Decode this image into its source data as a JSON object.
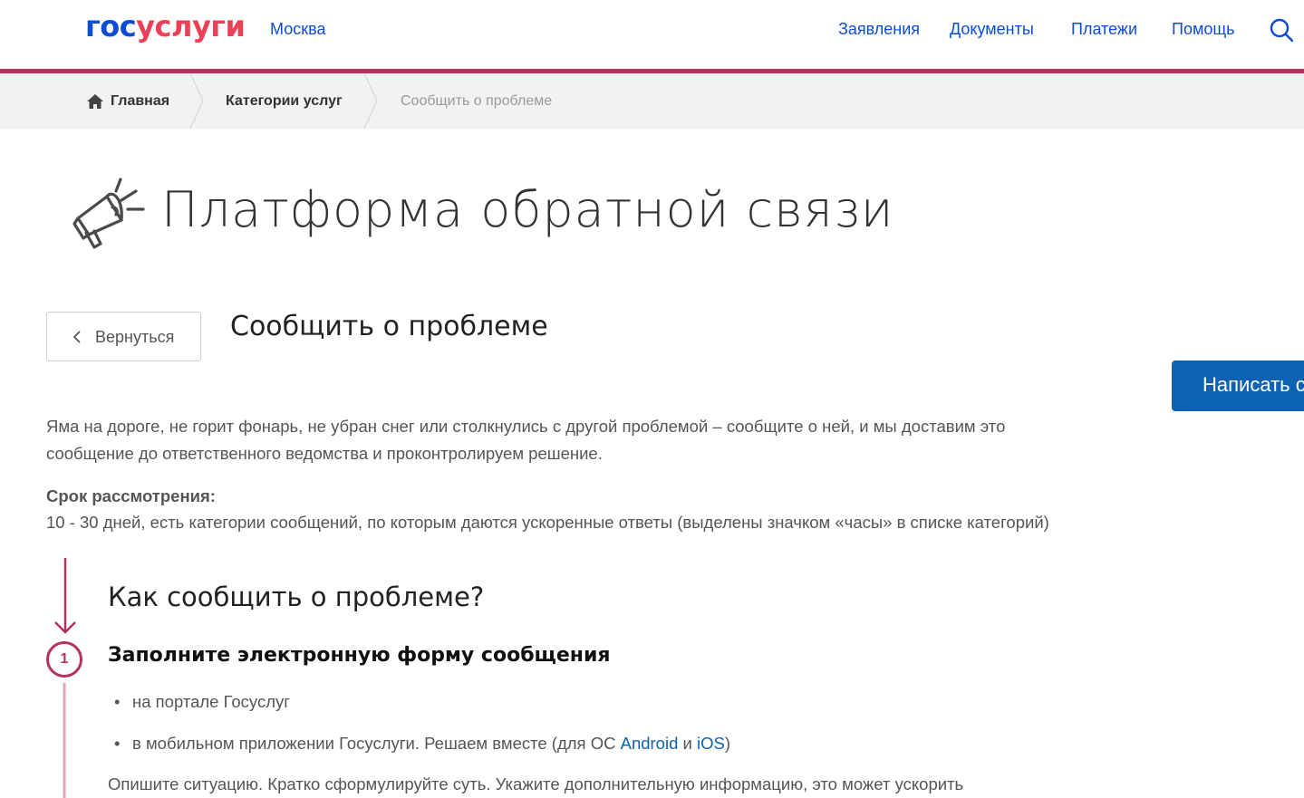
{
  "header": {
    "logo_part1": "гос",
    "logo_part2": "услуги",
    "city": "Москва",
    "nav": [
      "Заявления",
      "Документы",
      "Платежи",
      "Помощь"
    ]
  },
  "breadcrumbs": {
    "home": "Главная",
    "categories": "Категории услуг",
    "current": "Сообщить о проблеме"
  },
  "page": {
    "title": "Платформа обратной связи",
    "back_label": "Вернуться",
    "section_title": "Сообщить о проблеме",
    "write_button": "Написать с",
    "intro": "Яма на дороге, не горит фонарь, не убран снег или столкнулись с другой проблемой – сообщите о ней, и мы доставим это сообщение до ответственного ведомства и проконтролируем решение.",
    "term_title": "Срок рассмотрения:",
    "term_text": "10 - 30 дней, есть категории сообщений, по которым даются ускоренные ответы (выделены значком «часы» в списке категорий)"
  },
  "how": {
    "title": "Как сообщить о проблеме?",
    "step_number": "1",
    "step_title": "Заполните электронную форму сообщения",
    "bullet1": "на портале Госуслуг",
    "bullet2_text": "в мобильном приложении Госуслуги. Решаем вместе (для ОС",
    "bullet2_link1": "Android",
    "bullet2_and": "и",
    "bullet2_link2": "iOS",
    "bullet2_close": ")",
    "description": "Опишите ситуацию. Кратко сформулируйте суть. Укажите дополнительную информацию, это может ускорить"
  },
  "colors": {
    "brand_blue": "#0d4cd3",
    "brand_red": "#ee3f58",
    "accent_crimson": "#b5325a",
    "button_blue": "#0d62b3"
  }
}
